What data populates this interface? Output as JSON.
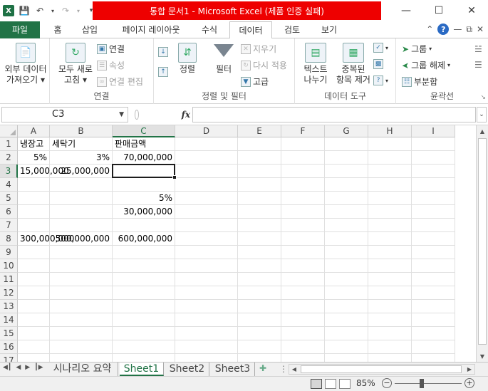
{
  "titlebar": {
    "title": "통합 문서1 - Microsoft Excel (제품 인증 실패)",
    "icons": [
      "excel-logo-icon",
      "save-icon",
      "undo-icon",
      "redo-icon",
      "customize-qat-icon"
    ],
    "controls": [
      "minimize-icon",
      "maximize-icon",
      "close-icon"
    ]
  },
  "tabs": [
    {
      "label": "파일"
    },
    {
      "label": "홈"
    },
    {
      "label": "삽입"
    },
    {
      "label": "페이지 레이아웃"
    },
    {
      "label": "수식"
    },
    {
      "label": "데이터"
    },
    {
      "label": "검토"
    },
    {
      "label": "보기"
    }
  ],
  "ribbon": {
    "get_external": {
      "label_line1": "외부 데이터",
      "label_line2": "가져오기"
    },
    "connections": {
      "refresh_line1": "모두 새로",
      "refresh_line2": "고침",
      "connections": "연결",
      "properties": "속성",
      "edit_links": "연결 편집",
      "group_label": "연결"
    },
    "sort_filter": {
      "sort": "정렬",
      "filter": "필터",
      "clear": "지우기",
      "reapply": "다시 적용",
      "advanced": "고급",
      "group_label": "정렬 및 필터"
    },
    "data_tools": {
      "text_to_cols_line1": "텍스트",
      "text_to_cols_line2": "나누기",
      "remove_dups_line1": "중복된",
      "remove_dups_line2": "항목 제거",
      "group_label": "데이터 도구"
    },
    "outline": {
      "group": "그룹",
      "ungroup": "그룹 해제",
      "subtotal": "부분합",
      "group_label": "윤곽선"
    }
  },
  "formula_bar": {
    "name_box": "C3",
    "fx": "fx",
    "formula": ""
  },
  "grid": {
    "columns": [
      "A",
      "B",
      "C",
      "D",
      "E",
      "F",
      "G",
      "H",
      "I"
    ],
    "rows": [
      "1",
      "2",
      "3",
      "4",
      "5",
      "6",
      "7",
      "8",
      "9",
      "10",
      "11",
      "12",
      "13",
      "14",
      "15",
      "16",
      "17"
    ],
    "selected_col": "C",
    "selected_row": "3",
    "cells": {
      "A1": "냉장고",
      "B1": "세탁기",
      "C1": "판매금액",
      "A2": "5%",
      "B2": "3%",
      "C2": "70,000,000",
      "A3": "15,000,000",
      "B3": "25,000,000",
      "C5": "5%",
      "C6": "30,000,000",
      "A8": "300,000,000",
      "B8": "500,000,000",
      "C8": "600,000,000"
    }
  },
  "sheets": {
    "tabs": [
      "시나리오 요약",
      "Sheet1",
      "Sheet2",
      "Sheet3"
    ],
    "active": "Sheet1"
  },
  "statusbar": {
    "zoom": "85%"
  }
}
